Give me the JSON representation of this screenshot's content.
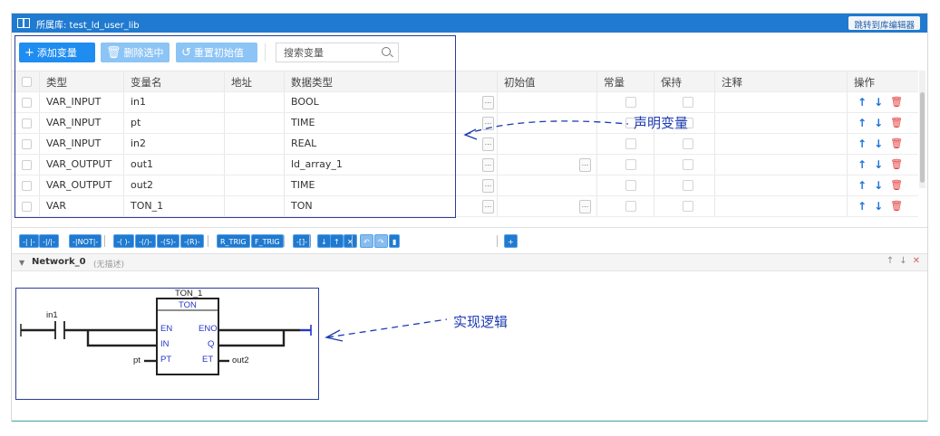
{
  "header": {
    "title": "所属库: test_ld_user_lib",
    "jump_button": "跳转到库编辑器"
  },
  "toolbar": {
    "add": "添加变量",
    "delete": "删除选中",
    "reset": "重置初始值",
    "search_placeholder": "搜索变量"
  },
  "table": {
    "columns": [
      "类型",
      "变量名",
      "地址",
      "数据类型",
      "初始值",
      "常量",
      "保持",
      "注释",
      "操作"
    ],
    "rows": [
      {
        "type": "VAR_INPUT",
        "name": "in1",
        "address": "",
        "datatype": "BOOL"
      },
      {
        "type": "VAR_INPUT",
        "name": "pt",
        "address": "",
        "datatype": "TIME"
      },
      {
        "type": "VAR_INPUT",
        "name": "in2",
        "address": "",
        "datatype": "REAL"
      },
      {
        "type": "VAR_OUTPUT",
        "name": "out1",
        "address": "",
        "datatype": "ld_array_1"
      },
      {
        "type": "VAR_OUTPUT",
        "name": "out2",
        "address": "",
        "datatype": "TIME"
      },
      {
        "type": "VAR",
        "name": "TON_1",
        "address": "",
        "datatype": "TON"
      }
    ],
    "more_glyph": "...",
    "op_up": "↑",
    "op_down": "↓",
    "op_delete": "🗑"
  },
  "annotations": {
    "declare": "声明变量",
    "implement": "实现逻辑"
  },
  "ld_toolbar": [
    "-| |-",
    "-|/|-",
    "-|NOT|-",
    "-( )-",
    "-(/)-",
    "-(S)-",
    "-(R)-",
    "R_TRIG",
    "F_TRIG",
    "-[]-",
    "↓",
    "↑",
    "✕",
    "↶",
    "↷",
    "▮",
    "+"
  ],
  "network": {
    "name": "Network_0",
    "desc": "(无描述)",
    "ctrl_up": "↑",
    "ctrl_down": "↓",
    "ctrl_close": "✕",
    "instance": "TON_1",
    "block_type": "TON",
    "pins": {
      "en": "EN",
      "eno": "ENO",
      "in": "IN",
      "q": "Q",
      "pt": "PT",
      "et": "ET"
    },
    "contact_var": "in1",
    "pt_var": "pt",
    "et_var": "out2"
  },
  "colors": {
    "header": "#1f7ad0",
    "primary": "#1f8df0",
    "annotation": "#1c3bb0",
    "ld_blue": "#2636c8"
  }
}
